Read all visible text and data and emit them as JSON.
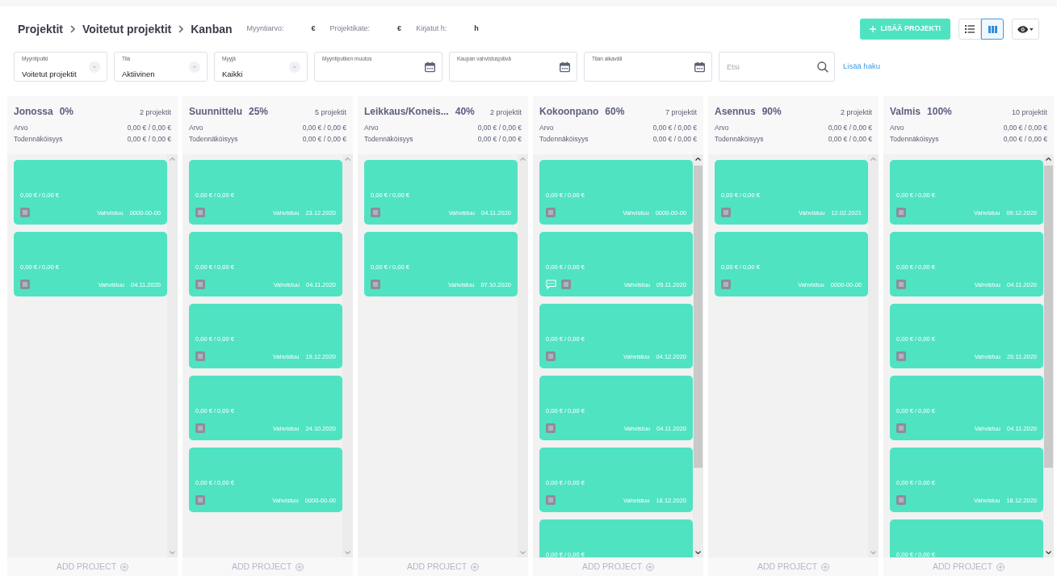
{
  "breadcrumb": [
    {
      "label": "Projektit"
    },
    {
      "label": "Voitetut projektit"
    },
    {
      "label": "Kanban"
    }
  ],
  "stats": [
    {
      "label": "Myyntiarvo:",
      "unit": "€"
    },
    {
      "label": "Projektikate:",
      "unit": "€"
    },
    {
      "label": "Kirjatut h:",
      "unit": "h"
    }
  ],
  "add_button": "LISÄÄ PROJEKTI",
  "view_toggle": [
    {
      "kind": "list",
      "selected": false
    },
    {
      "kind": "kanban",
      "selected": true
    }
  ],
  "filters": [
    {
      "kind": "select",
      "label": "Myyntiputki",
      "value": "Voitetut projektit"
    },
    {
      "kind": "select",
      "label": "Tila",
      "value": "Aktiivinen"
    },
    {
      "kind": "select",
      "label": "Myyjä",
      "value": "Kaikki"
    },
    {
      "kind": "date",
      "label": "Myyntiputken muutos"
    },
    {
      "kind": "date",
      "label": "Kaupan vahvistuspäivä"
    },
    {
      "kind": "date",
      "label": "Tilan aikaväli"
    },
    {
      "kind": "search",
      "placeholder": "Etsi"
    }
  ],
  "more_search_link": "Lisää haku",
  "columns": [
    {
      "name": "Jonossa",
      "percent": "0%",
      "count": "2 projektit",
      "rows": [
        {
          "label": "Arvo",
          "value": "0,00 € / 0,00 €"
        },
        {
          "label": "Todennäköisyys",
          "value": "0,00 € / 0,00 €"
        }
      ],
      "cards": [
        {
          "amount": "0,00 € / 0,00 €",
          "has_comment": false,
          "confirm_label": "Vahvistuu",
          "date": "0000-00-00"
        },
        {
          "amount": "0,00 € / 0,00 €",
          "has_comment": false,
          "confirm_label": "Vahvistuu",
          "date": "04.11.2020"
        }
      ],
      "add_label": "ADD PROJECT"
    },
    {
      "name": "Suunnittelu",
      "percent": "25%",
      "count": "5 projektit",
      "rows": [
        {
          "label": "Arvo",
          "value": "0,00 € / 0,00 €"
        },
        {
          "label": "Todennäköisyys",
          "value": "0,00 € / 0,00 €"
        }
      ],
      "cards": [
        {
          "amount": "0,00 € / 0,00 €",
          "has_comment": false,
          "confirm_label": "Vahvistuu",
          "date": "23.12.2020"
        },
        {
          "amount": "0,00 € / 0,00 €",
          "has_comment": false,
          "confirm_label": "Vahvistuu",
          "date": "04.11.2020"
        },
        {
          "amount": "0,00 € / 0,00 €",
          "has_comment": false,
          "confirm_label": "Vahvistuu",
          "date": "19.12.2020"
        },
        {
          "amount": "0,00 € / 0,00 €",
          "has_comment": false,
          "confirm_label": "Vahvistuu",
          "date": "24.10.2020"
        },
        {
          "amount": "0,00 € / 0,00 €",
          "has_comment": false,
          "confirm_label": "Vahvistuu",
          "date": "0000-00-00"
        }
      ],
      "add_label": "ADD PROJECT"
    },
    {
      "name": "Leikkaus/Koneis...",
      "percent": "40%",
      "count": "2 projektit",
      "rows": [
        {
          "label": "Arvo",
          "value": "0,00 € / 0,00 €"
        },
        {
          "label": "Todennäköisyys",
          "value": "0,00 € / 0,00 €"
        }
      ],
      "cards": [
        {
          "amount": "0,00 € / 0,00 €",
          "has_comment": false,
          "confirm_label": "Vahvistuu",
          "date": "04.11.2020"
        },
        {
          "amount": "0,00 € / 0,00 €",
          "has_comment": false,
          "confirm_label": "Vahvistuu",
          "date": "07.10.2020"
        }
      ],
      "add_label": "ADD PROJECT"
    },
    {
      "name": "Kokoonpano",
      "percent": "60%",
      "count": "7 projektit",
      "rows": [
        {
          "label": "Arvo",
          "value": "0,00 € / 0,00 €"
        },
        {
          "label": "Todennäköisyys",
          "value": "0,00 € / 0,00 €"
        }
      ],
      "cards": [
        {
          "amount": "0,00 € / 0,00 €",
          "has_comment": false,
          "confirm_label": "Vahvistuu",
          "date": "0000-00-00"
        },
        {
          "amount": "0,00 € / 0,00 €",
          "has_comment": true,
          "confirm_label": "Vahvistuu",
          "date": "05.11.2020"
        },
        {
          "amount": "0,00 € / 0,00 €",
          "has_comment": false,
          "confirm_label": "Vahvistuu",
          "date": "04.12.2020"
        },
        {
          "amount": "0,00 € / 0,00 €",
          "has_comment": false,
          "confirm_label": "Vahvistuu",
          "date": "04.11.2020"
        },
        {
          "amount": "0,00 € / 0,00 €",
          "has_comment": false,
          "confirm_label": "Vahvistuu",
          "date": "18.12.2020"
        },
        {
          "amount": "0,00 € / 0,00 €"
        }
      ],
      "add_label": "ADD PROJECT"
    },
    {
      "name": "Asennus",
      "percent": "90%",
      "count": "2 projektit",
      "rows": [
        {
          "label": "Arvo",
          "value": "0,00 € / 0,00 €"
        },
        {
          "label": "Todennäköisyys",
          "value": "0,00 € / 0,00 €"
        }
      ],
      "cards": [
        {
          "amount": "0,00 € / 0,00 €",
          "has_comment": false,
          "confirm_label": "Vahvistuu",
          "date": "12.02.2021"
        },
        {
          "amount": "0,00 € / 0,00 €",
          "has_comment": false,
          "confirm_label": "Vahvistuu",
          "date": "0000-00-00"
        }
      ],
      "add_label": "ADD PROJECT"
    },
    {
      "name": "Valmis",
      "percent": "100%",
      "count": "10 projektit",
      "rows": [
        {
          "label": "Arvo",
          "value": "0,00 € / 0,00 €"
        },
        {
          "label": "Todennäköisyys",
          "value": "0,00 € / 0,00 €"
        }
      ],
      "cards": [
        {
          "amount": "0,00 € / 0,00 €",
          "has_comment": false,
          "confirm_label": "Vahvistuu",
          "date": "09.12.2020"
        },
        {
          "amount": "0,00 € / 0,00 €",
          "has_comment": false,
          "confirm_label": "Vahvistuu",
          "date": "04.11.2020"
        },
        {
          "amount": "0,00 € / 0,00 €",
          "has_comment": false,
          "confirm_label": "Vahvistuu",
          "date": "20.11.2020"
        },
        {
          "amount": "0,00 € / 0,00 €",
          "has_comment": false,
          "confirm_label": "Vahvistuu",
          "date": "04.11.2020"
        },
        {
          "amount": "0,00 € / 0,00 €",
          "has_comment": false,
          "confirm_label": "Vahvistuu",
          "date": "18.12.2020"
        },
        {
          "amount": "0,00 € / 0,00 €"
        }
      ],
      "add_label": "ADD PROJECT"
    }
  ]
}
